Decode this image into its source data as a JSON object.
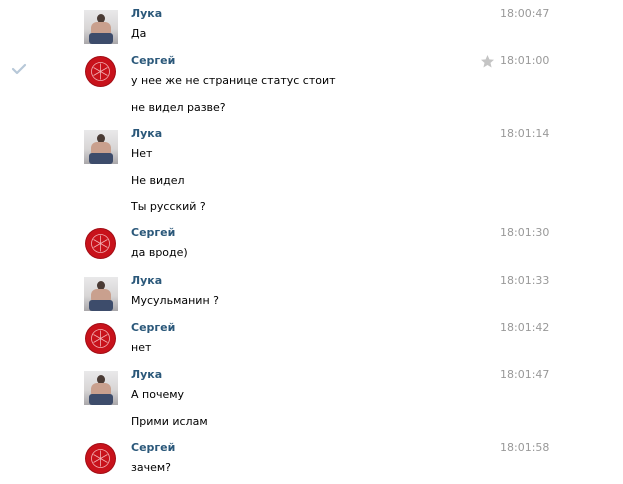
{
  "messages": [
    {
      "author": "Лука",
      "avatar": "photo-avatar",
      "time": "18:00:47",
      "lines": [
        "Да"
      ]
    },
    {
      "author": "Сергей",
      "avatar": "red-logo-avatar",
      "time": "18:01:00",
      "lines": [
        "у нее же не странице статус стоит",
        "не видел разве?"
      ],
      "selected": true,
      "starred": true
    },
    {
      "author": "Лука",
      "avatar": "photo-avatar",
      "time": "18:01:14",
      "lines": [
        "Нет",
        "Не видел",
        "Ты русский ?"
      ]
    },
    {
      "author": "Сергей",
      "avatar": "red-logo-avatar",
      "time": "18:01:30",
      "lines": [
        "да вроде)"
      ]
    },
    {
      "author": "Лука",
      "avatar": "photo-avatar",
      "time": "18:01:33",
      "lines": [
        "Мусульманин ?"
      ]
    },
    {
      "author": "Сергей",
      "avatar": "red-logo-avatar",
      "time": "18:01:42",
      "lines": [
        "нет"
      ]
    },
    {
      "author": "Лука",
      "avatar": "photo-avatar",
      "time": "18:01:47",
      "lines": [
        "А почему",
        "Прими ислам"
      ]
    },
    {
      "author": "Сергей",
      "avatar": "red-logo-avatar",
      "time": "18:01:58",
      "lines": [
        "зачем?"
      ]
    }
  ],
  "icons": {
    "check": "checkmark-icon",
    "star": "star-icon"
  },
  "colors": {
    "author": "#2b587a",
    "time": "#999999",
    "text": "#000000",
    "logo_red": "#c8121b",
    "check": "#b7c8d8",
    "star": "#c4c4c4"
  }
}
